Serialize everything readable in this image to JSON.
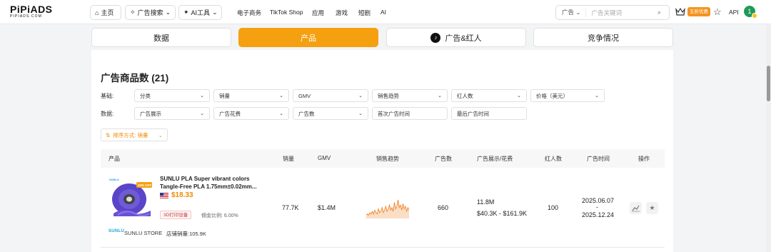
{
  "header": {
    "logo_main": "PiPiADS",
    "logo_sub": "PIPIADS.COM",
    "nav": {
      "home": "主页",
      "ad_search": "广告搜索",
      "ai_tools": "AI工具",
      "ecommerce": "电子商务",
      "tiktok_shop": "TikTok Shop",
      "apps": "应用",
      "games": "游戏",
      "short_drama": "短剧",
      "ai": "AI"
    },
    "search": {
      "type": "广告",
      "placeholder": "广告关键词"
    },
    "promo_badge": "五折优惠",
    "api": "API",
    "avatar_initial": "1"
  },
  "tabs": {
    "data": "数据",
    "products": "产品",
    "ads_influencers": "广告&红人",
    "competition": "竞争情况",
    "active": "products"
  },
  "section": {
    "title": "广告商品数 (21)"
  },
  "filters": {
    "basic_label": "基础:",
    "data_label": "数据:",
    "basic": [
      "分类",
      "销量",
      "GMV",
      "销售趋势",
      "红人数",
      "价格（美元）"
    ],
    "data": [
      "广告展示",
      "广告花费",
      "广告数",
      "首次广告时间",
      "最后广告时间"
    ]
  },
  "sort": {
    "label": "排序方式: 销量"
  },
  "table": {
    "headers": [
      "产品",
      "销量",
      "GMV",
      "销售趋势",
      "广告数",
      "广告展示/花费",
      "红人数",
      "广告时间",
      "操作"
    ],
    "rows": [
      {
        "product_name": "SUNLU PLA Super vibrant colors Tangle-Free PLA 1.75mm±0.02mm...",
        "price": "$18.33",
        "category": "3D打印设备",
        "commission": "佣金比例: 6.00%",
        "image_badge": "40% OFF",
        "brand_mark": "SUNLU",
        "store_logo": "SUNLU",
        "store_name": "SUNLU STORE",
        "store_sales": "店铺销量:105.9K",
        "sales": "77.7K",
        "gmv": "$1.4M",
        "sales_trend": [
          2,
          3,
          2,
          4,
          3,
          5,
          3,
          6,
          4,
          3,
          7,
          4,
          5,
          8,
          4,
          6,
          9,
          5,
          7,
          10,
          6,
          8,
          5,
          12,
          7,
          9,
          14,
          8,
          10,
          6,
          11,
          7,
          9,
          5,
          8,
          6
        ],
        "trend_color": "#f07a1a",
        "ads": "660",
        "impressions": "11.8M",
        "spend": "$40.3K - $161.9K",
        "influencers": "100",
        "ad_start": "2025.06.07",
        "ad_sep": "-",
        "ad_end": "2025.12.24"
      }
    ]
  },
  "colors": {
    "accent": "#f5a010",
    "promo": "#f5931f",
    "price": "#f08a00"
  }
}
